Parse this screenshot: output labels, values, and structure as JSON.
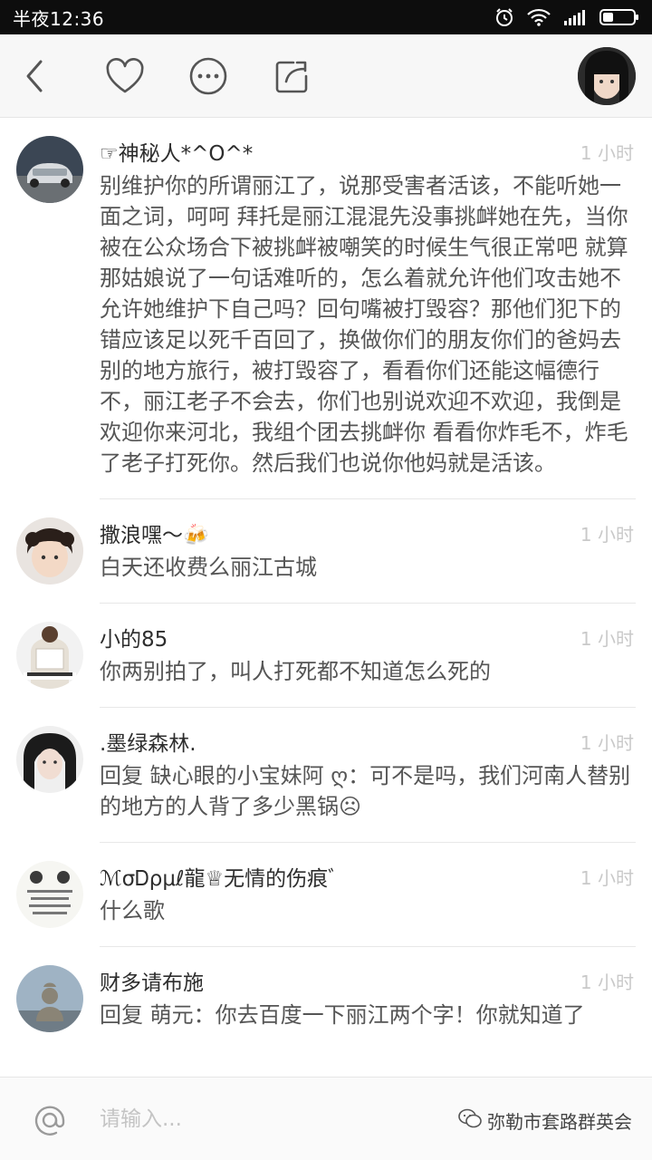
{
  "status_bar": {
    "time": "半夜12:36"
  },
  "header": {
    "back_icon": "chevron-left-icon",
    "like_icon": "heart-icon",
    "more_icon": "more-dots-icon",
    "share_icon": "share-icon"
  },
  "comments": [
    {
      "name": "☞神秘人*^O^*",
      "time": "1 小时",
      "text": "别维护你的所谓丽江了，说那受害者活该，不能听她一面之词，呵呵  拜托是丽江混混先没事挑衅她在先，当你被在公众场合下被挑衅被嘲笑的时候生气很正常吧 就算那姑娘说了一句话难听的，怎么着就允许他们攻击她不允许她维护下自己吗？回句嘴被打毁容？那他们犯下的错应该足以死千百回了，换做你们的朋友你们的爸妈去别的地方旅行，被打毁容了，看看你们还能这幅德行不，丽江老子不会去，你们也别说欢迎不欢迎，我倒是欢迎你来河北，我组个团去挑衅你  看看你炸毛不，炸毛了老子打死你。然后我们也说你他妈就是活该。"
    },
    {
      "name": "撒浪嘿～🍻",
      "time": "1 小时",
      "text": "白天还收费么丽江古城"
    },
    {
      "name": "小的85",
      "time": "1 小时",
      "text": "你两别拍了，叫人打死都不知道怎么死的"
    },
    {
      "name": ".墨绿森林.",
      "time": "1 小时",
      "text": "回复 缺心眼的小宝妹阿 ღ：可不是吗，我们河南人替别的地方的人背了多少黑锅☹"
    },
    {
      "name": "ℳσᎠρμℓ龍♕无情的伤痕ﾞ",
      "time": "1 小时",
      "text": "什么歌"
    },
    {
      "name": "财多请布施",
      "time": "1 小时",
      "text": "回复 萌元：你去百度一下丽江两个字！你就知道了"
    }
  ],
  "input_bar": {
    "placeholder": "请输入...",
    "watermark": "弥勒市套路群英会"
  }
}
